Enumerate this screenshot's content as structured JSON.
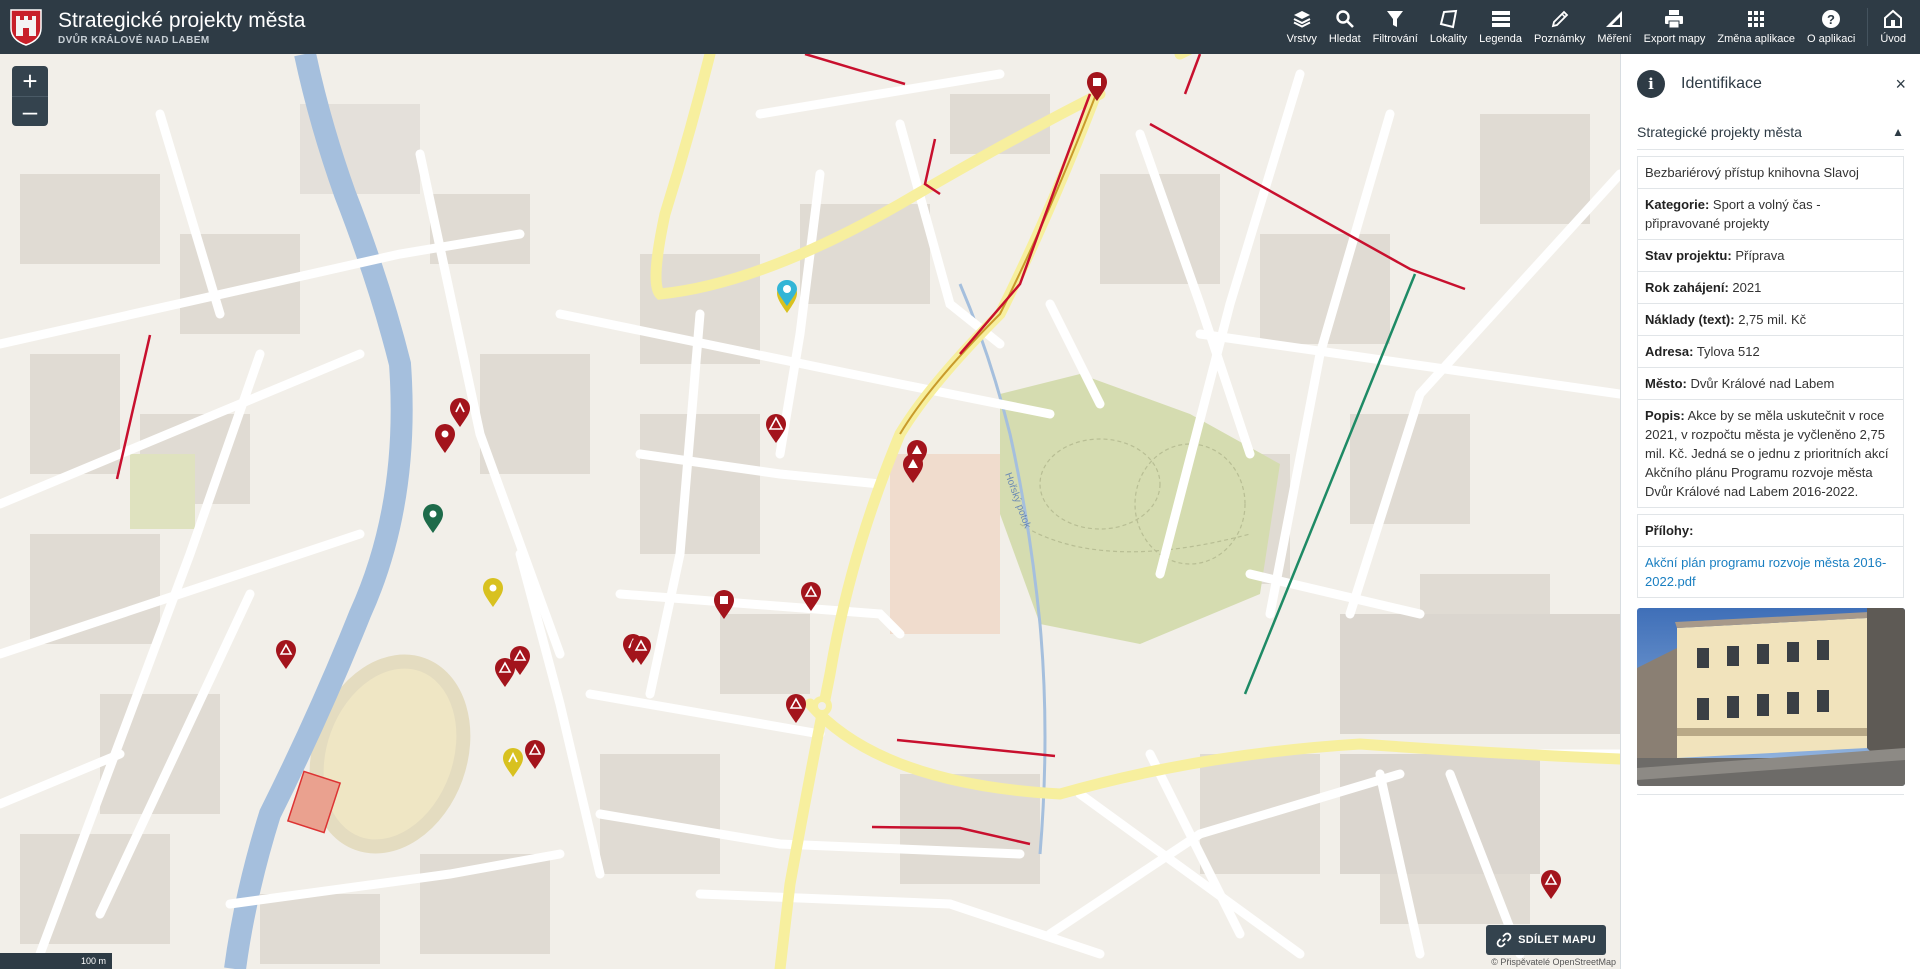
{
  "header": {
    "title": "Strategické projekty města",
    "subtitle": "DVŮR KRÁLOVÉ NAD LABEM"
  },
  "toolbar": [
    {
      "label": "Vrstvy",
      "icon": "layers-icon"
    },
    {
      "label": "Hledat",
      "icon": "search-icon"
    },
    {
      "label": "Filtrování",
      "icon": "filter-icon"
    },
    {
      "label": "Lokality",
      "icon": "polygon-icon"
    },
    {
      "label": "Legenda",
      "icon": "legend-icon"
    },
    {
      "label": "Poznámky",
      "icon": "pencil-icon"
    },
    {
      "label": "Měření",
      "icon": "ruler-icon"
    },
    {
      "label": "Export mapy",
      "icon": "printer-icon"
    },
    {
      "label": "Změna aplikace",
      "icon": "grid-icon"
    },
    {
      "label": "O aplikaci",
      "icon": "help-icon"
    },
    {
      "label": "Úvod",
      "icon": "home-icon"
    }
  ],
  "map": {
    "zoom_in": "+",
    "zoom_out": "–",
    "share_label": "SDÍLET MAPU",
    "scale_label": "100 m",
    "attribution": "© Přispěvatelé OpenStreetMap",
    "stream_label": "Hořský potok"
  },
  "panel": {
    "title": "Identifikace",
    "close": "×",
    "layer_title": "Strategické projekty města",
    "feature_name": "Bezbariérový přístup knihovna Slavoj",
    "attributes": [
      {
        "label": "Kategorie:",
        "value": "Sport a volný čas - připravované projekty"
      },
      {
        "label": "Stav projektu:",
        "value": "Příprava"
      },
      {
        "label": "Rok zahájení:",
        "value": "2021"
      },
      {
        "label": "Náklady (text):",
        "value": "2,75 mil. Kč"
      },
      {
        "label": "Adresa:",
        "value": "Tylova 512"
      },
      {
        "label": "Město:",
        "value": "Dvůr Králové nad Labem"
      },
      {
        "label": "Popis:",
        "value": "Akce by se měla uskutečnit v roce 2021, v rozpočtu města je vyčleněno 2,75 mil. Kč. Jedná se o jednu z prioritních akcí Akčního plánu Programu rozvoje města Dvůr Králové nad Labem 2016-2022."
      }
    ],
    "attachments_label": "Přílohy:",
    "attachment_link": "Akční plán programu rozvoje města 2016-2022.pdf"
  },
  "colors": {
    "header_bg": "#2e3b45",
    "pin_red": "#a3141c",
    "pin_green": "#1e6b4a",
    "pin_yellow": "#d8c11f",
    "pin_selected": "#33b5d6",
    "road_major": "#f7ef9e",
    "river": "#a5bfdd",
    "park": "#d5dcb0",
    "link": "#1a7fc1"
  }
}
